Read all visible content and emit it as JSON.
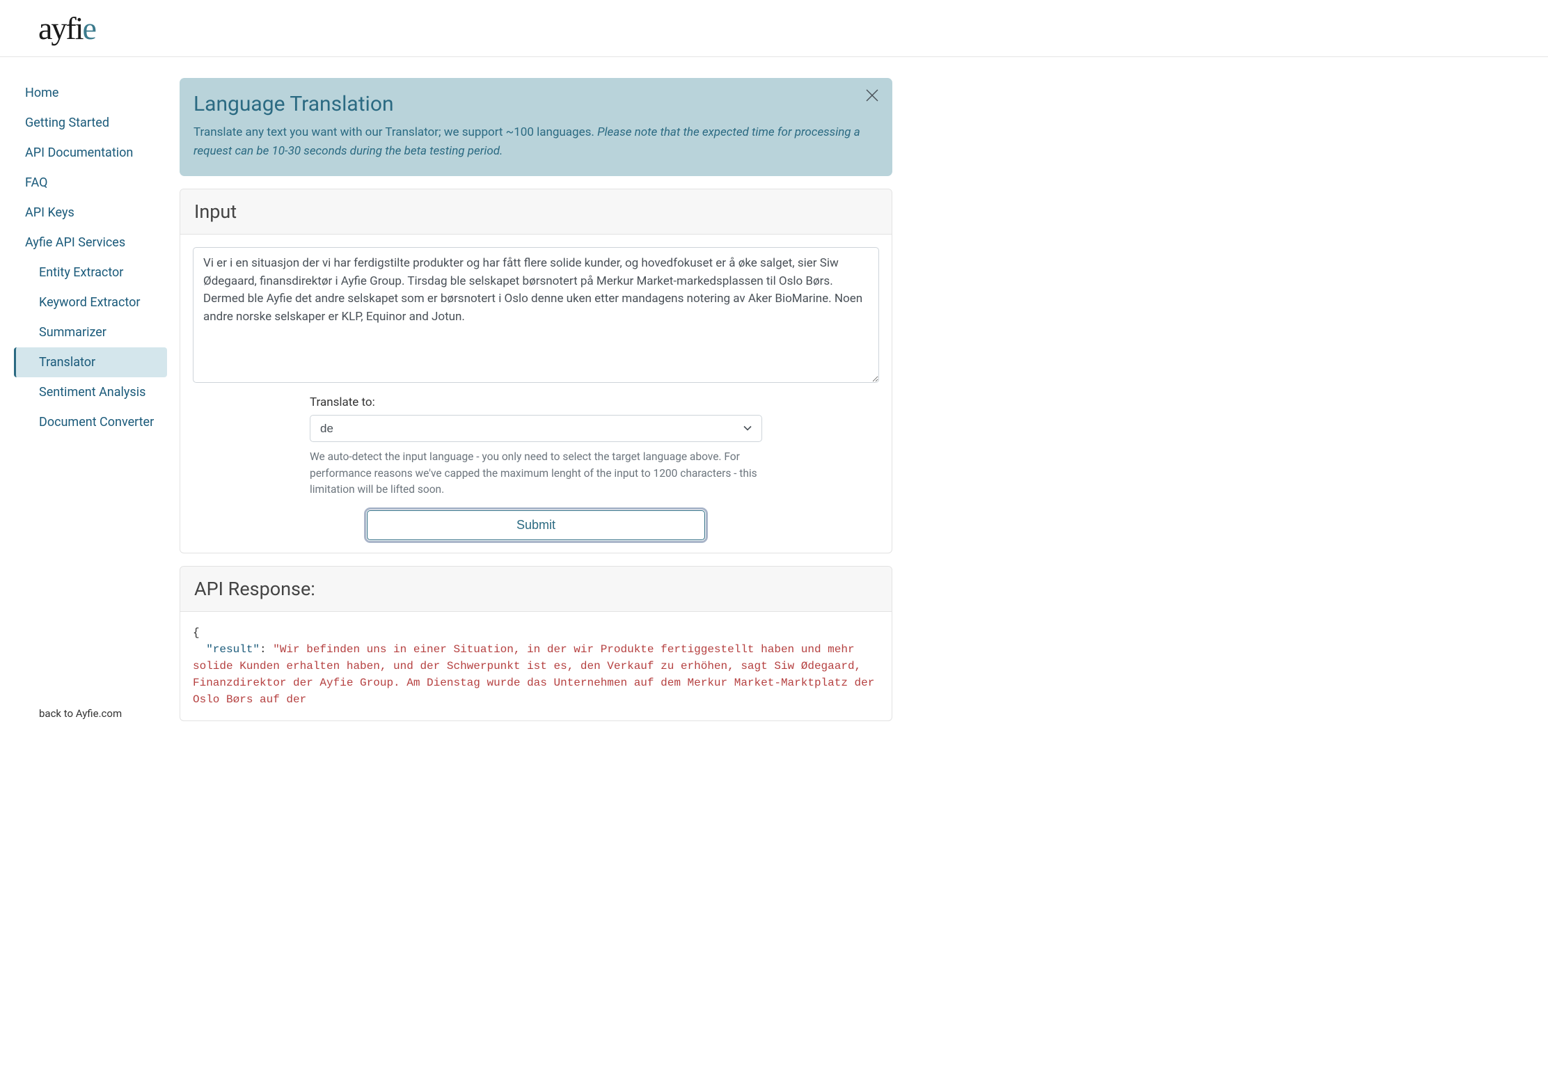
{
  "logo": {
    "main": "ayfi",
    "accent": "e"
  },
  "sidebar": {
    "items": [
      {
        "label": "Home",
        "indent": false,
        "active": false
      },
      {
        "label": "Getting Started",
        "indent": false,
        "active": false
      },
      {
        "label": "API Documentation",
        "indent": false,
        "active": false
      },
      {
        "label": "FAQ",
        "indent": false,
        "active": false
      },
      {
        "label": "API Keys",
        "indent": false,
        "active": false
      },
      {
        "label": "Ayfie API Services",
        "indent": false,
        "active": false,
        "parent": true
      },
      {
        "label": "Entity Extractor",
        "indent": true,
        "active": false
      },
      {
        "label": "Keyword Extractor",
        "indent": true,
        "active": false
      },
      {
        "label": "Summarizer",
        "indent": true,
        "active": false
      },
      {
        "label": "Translator",
        "indent": true,
        "active": true
      },
      {
        "label": "Sentiment Analysis",
        "indent": true,
        "active": false
      },
      {
        "label": "Document Converter",
        "indent": true,
        "active": false
      }
    ],
    "footer": "back to Ayfie.com"
  },
  "banner": {
    "title": "Language Translation",
    "text": "Translate any text you want with our Translator; we support ~100 languages. ",
    "note": "Please note that the expected time for processing a request can be 10-30 seconds during the beta testing period."
  },
  "input": {
    "header": "Input",
    "textarea_value": "Vi er i en situasjon der vi har ferdigstilte produkter og har fått flere solide kunder, og hovedfokuset er å øke salget, sier Siw Ødegaard, finansdirektør i Ayfie Group. Tirsdag ble selskapet børsnotert på Merkur Market-markedsplassen til Oslo Børs. Dermed ble Ayfie det andre selskapet som er børsnotert i Oslo denne uken etter mandagens notering av Aker BioMarine. Noen andre norske selskaper er KLP, Equinor and Jotun.",
    "translate_label": "Translate to:",
    "select_value": "de",
    "help_text": "We auto-detect the input language - you only need to select the target language above. For performance reasons we've capped the maximum lenght of the input to 1200 characters - this limitation will be lifted soon.",
    "submit_label": "Submit"
  },
  "response": {
    "header": "API Response:",
    "json_key": "\"result\"",
    "json_value": "\"Wir befinden uns in einer Situation, in der wir Produkte fertiggestellt haben und mehr solide Kunden erhalten haben, und der Schwerpunkt ist es, den Verkauf zu erhöhen, sagt Siw Ødegaard, Finanzdirektor der Ayfie Group. Am Dienstag wurde das Unternehmen auf dem Merkur Market-Marktplatz der Oslo Børs auf der"
  }
}
